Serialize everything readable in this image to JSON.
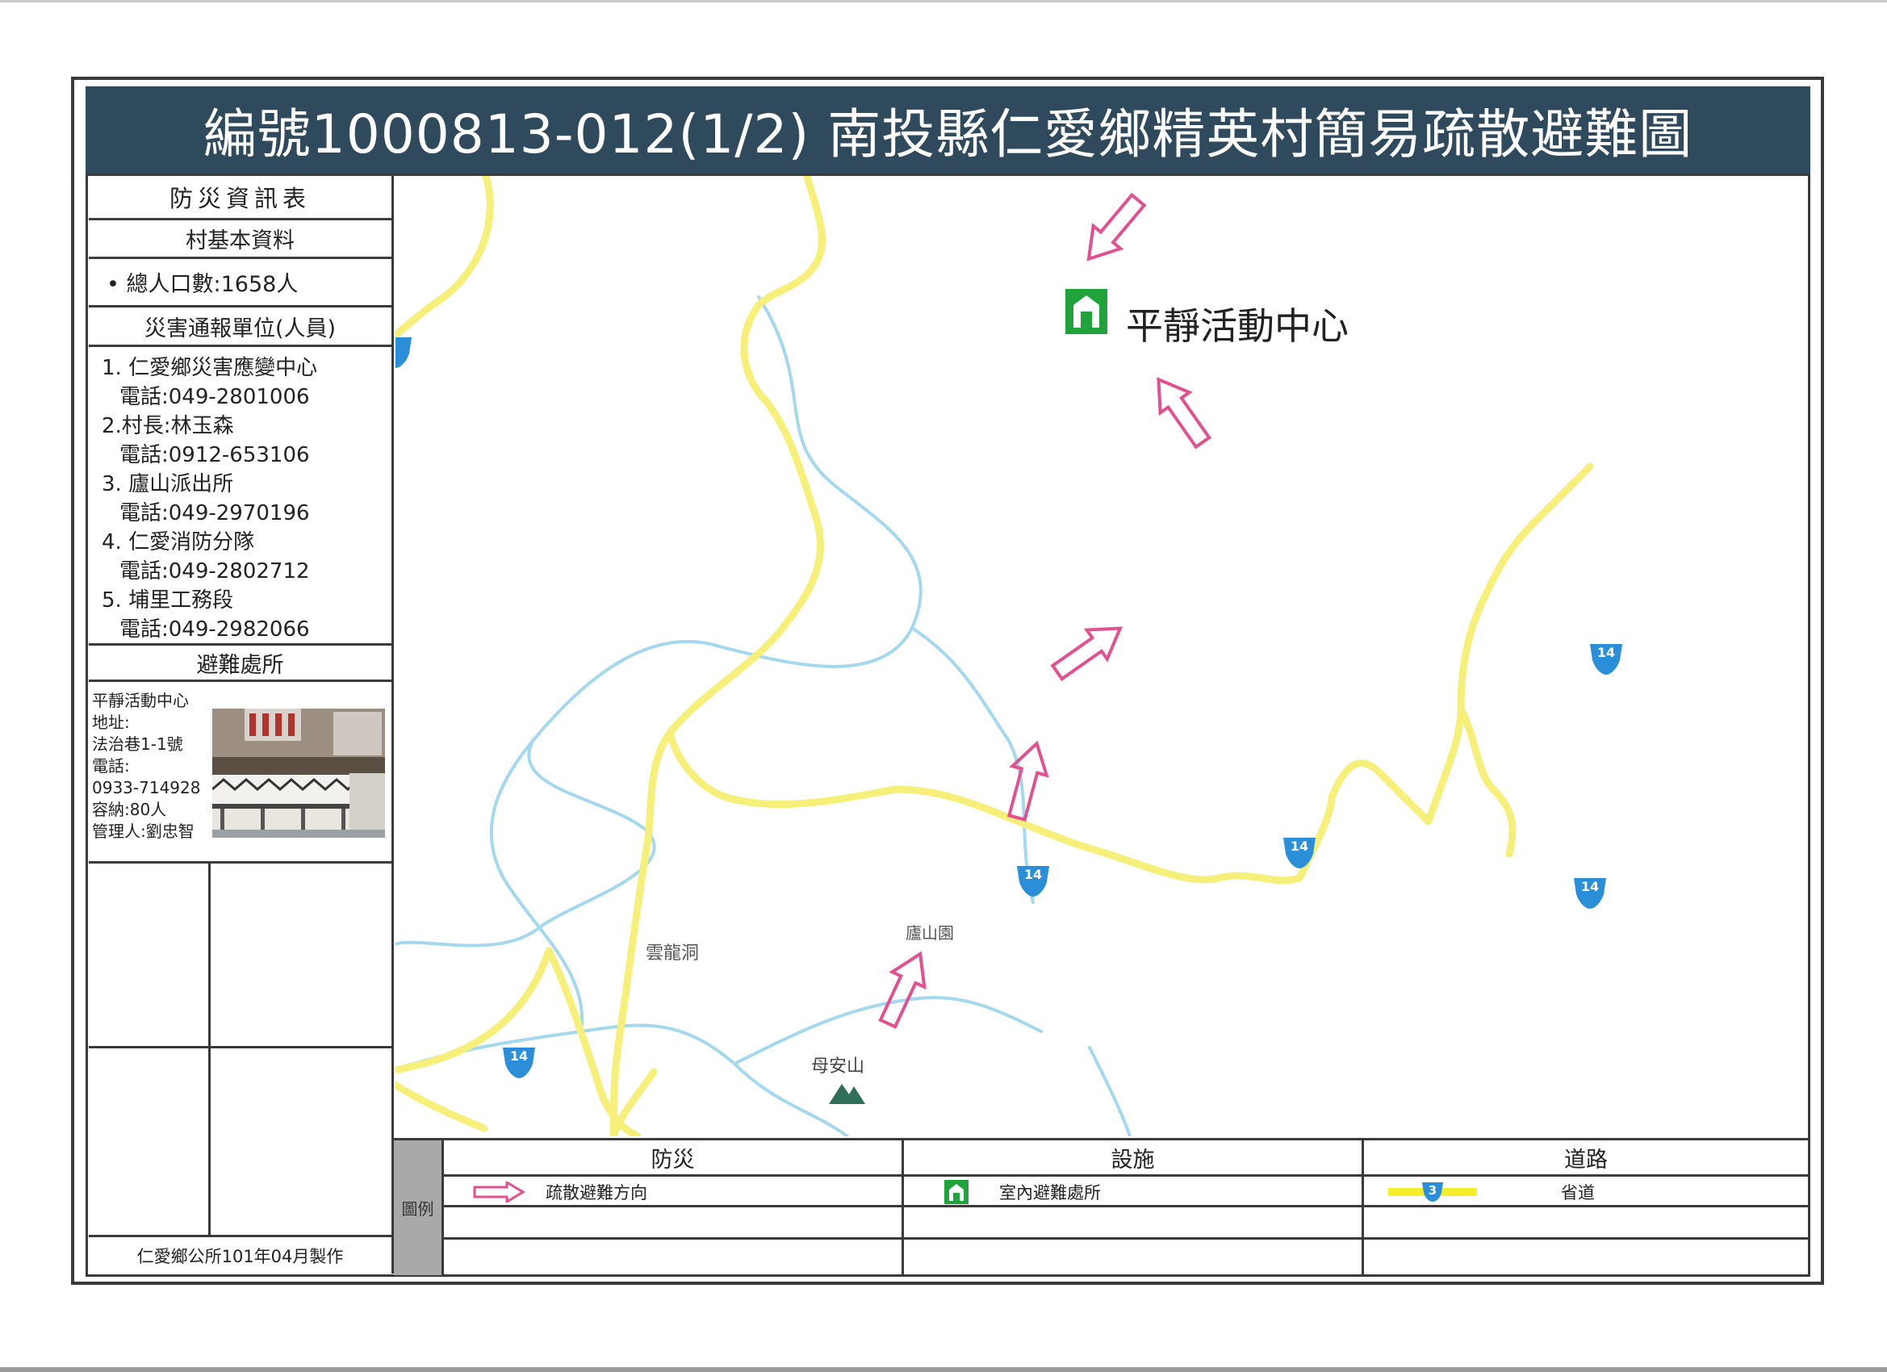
{
  "title": "編號1000813-012(1/2)  南投縣仁愛鄉精英村簡易疏散避難圖",
  "sidebar": {
    "header": "防災資訊表",
    "village_basic_header": "村基本資料",
    "population": "• 總人口數:1658人",
    "report_units_header": "災害通報單位(人員)",
    "contacts": [
      {
        "name": "1. 仁愛鄉災害應變中心",
        "phone": "電話:049-2801006"
      },
      {
        "name": "2.村長:林玉森",
        "phone": "電話:0912-653106"
      },
      {
        "name": "3. 廬山派出所",
        "phone": "電話:049-2970196"
      },
      {
        "name": "4. 仁愛消防分隊",
        "phone": "電話:049-2802712"
      },
      {
        "name": "5. 埔里工務段",
        "phone": "電話:049-2982066"
      }
    ],
    "shelter_header": "避難處所",
    "shelter": {
      "name": "平靜活動中心",
      "address_label": "地址:",
      "address": "法治巷1-1號",
      "phone_label": "電話:",
      "phone": "0933-714928",
      "capacity": "容納:80人",
      "manager": "管理人:劉忠智"
    },
    "footer": "仁愛鄉公所101年04月製作"
  },
  "map": {
    "shelter_label": "平靜活動中心",
    "place_labels": [
      "雲龍洞",
      "廬山園",
      "母安山"
    ],
    "route_marker": "14",
    "colors": {
      "road": "#f6f07a",
      "river": "#9fd6ec",
      "arrow": "#e3508f",
      "shelter": "#1fa33a",
      "route_badge": "#2a8fd8"
    }
  },
  "legend": {
    "label": "圖例",
    "col1_header": "防災",
    "col2_header": "設施",
    "col3_header": "道路",
    "evac_direction": "疏散避難方向",
    "indoor_shelter": "室內避難處所",
    "provincial_road": "省道",
    "provincial_road_marker": "3"
  }
}
